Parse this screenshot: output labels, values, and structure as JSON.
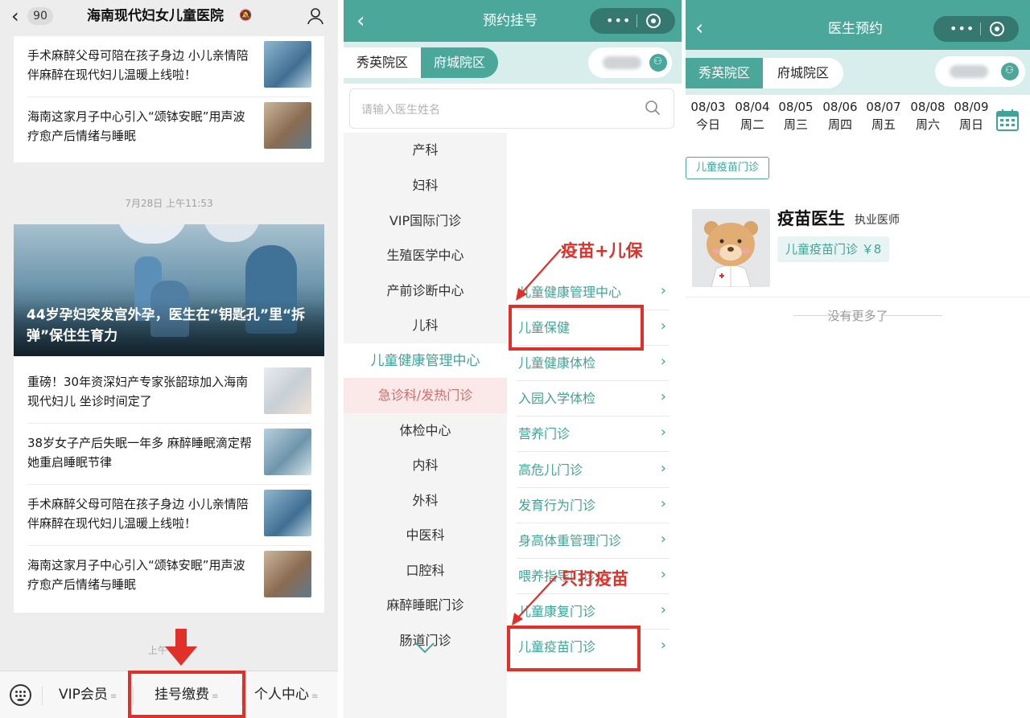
{
  "news_panel": {
    "back_count": "90",
    "title": "海南现代妇女儿童医院",
    "top_items": [
      "手术麻醉父母可陪在孩子身边 小儿亲情陪伴麻醉在现代妇儿温暖上线啦！",
      "海南这家月子中心引入“颂钵安眠”用声波疗愈产后情绪与睡眠"
    ],
    "time_label": "7月28日 上午11:53",
    "hero_caption": "44岁孕妇突发宫外孕，医生在“钥匙孔”里“拆弹”保住生育力",
    "bottom_items": [
      "重磅！30年资深妇产专家张韶琼加入海南现代妇儿 坐诊时间定了",
      "38岁女子产后失眠一年多 麻醉睡眠滴定帮她重启睡眠节律",
      "手术麻醉父母可陪在孩子身边 小儿亲情陪伴麻醉在现代妇儿温暖上线啦！",
      "海南这家月子中心引入“颂钵安眠”用声波疗愈产后情绪与睡眠"
    ],
    "bottom_time_partial": "上午",
    "tabs": [
      "VIP会员",
      "挂号缴费",
      "个人中心"
    ],
    "tab_mark": "≡"
  },
  "booking_panel": {
    "title": "预约挂号",
    "branches": [
      "秀英院区",
      "府城院区"
    ],
    "active_branch": "府城院区",
    "search_placeholder": "请输入医生姓名",
    "departments": [
      "产科",
      "妇科",
      "VIP国际门诊",
      "生殖医学中心",
      "产前诊断中心",
      "儿科",
      "儿童健康管理中心",
      "急诊科/发热门诊",
      "体检中心",
      "内科",
      "外科",
      "中医科",
      "口腔科",
      "麻醉睡眠门诊",
      "肠道门诊"
    ],
    "active_department": "儿童健康管理中心",
    "sub_departments": [
      "儿童健康管理中心",
      "儿童保健",
      "儿童健康体检",
      "入园入学体检",
      "营养门诊",
      "高危儿门诊",
      "发育行为门诊",
      "身高体重管理门诊",
      "喂养指导门诊",
      "儿童康复门诊",
      "儿童疫苗门诊"
    ],
    "annotation_top": "疫苗+儿保",
    "annotation_bottom": "只打疫苗"
  },
  "doctor_panel": {
    "title": "医生预约",
    "branches": [
      "秀英院区",
      "府城院区"
    ],
    "active_branch": "秀英院区",
    "dates": [
      {
        "date": "08/03",
        "weekday": "今日"
      },
      {
        "date": "08/04",
        "weekday": "周二"
      },
      {
        "date": "08/05",
        "weekday": "周三"
      },
      {
        "date": "08/06",
        "weekday": "周四"
      },
      {
        "date": "08/07",
        "weekday": "周五"
      },
      {
        "date": "08/08",
        "weekday": "周六"
      },
      {
        "date": "08/09",
        "weekday": "周日"
      }
    ],
    "filter_chip": "儿童疫苗门诊",
    "doctor": {
      "name": "疫苗医生",
      "title": "执业医师",
      "fee": "儿童疫苗门诊  ￥8"
    },
    "no_more": "没有更多了"
  },
  "colors": {
    "teal": "#4aa79a",
    "teal_light": "#d8eeec",
    "annotation_red": "#e0302a"
  },
  "icons": [
    "back-chevron-icon",
    "bell-off-icon",
    "user-icon",
    "search-icon",
    "calendar-icon",
    "keyboard-icon",
    "more-dots-icon",
    "close-circle-icon",
    "chevron-right-icon",
    "chevron-down-icon",
    "red-arrow-icon"
  ]
}
